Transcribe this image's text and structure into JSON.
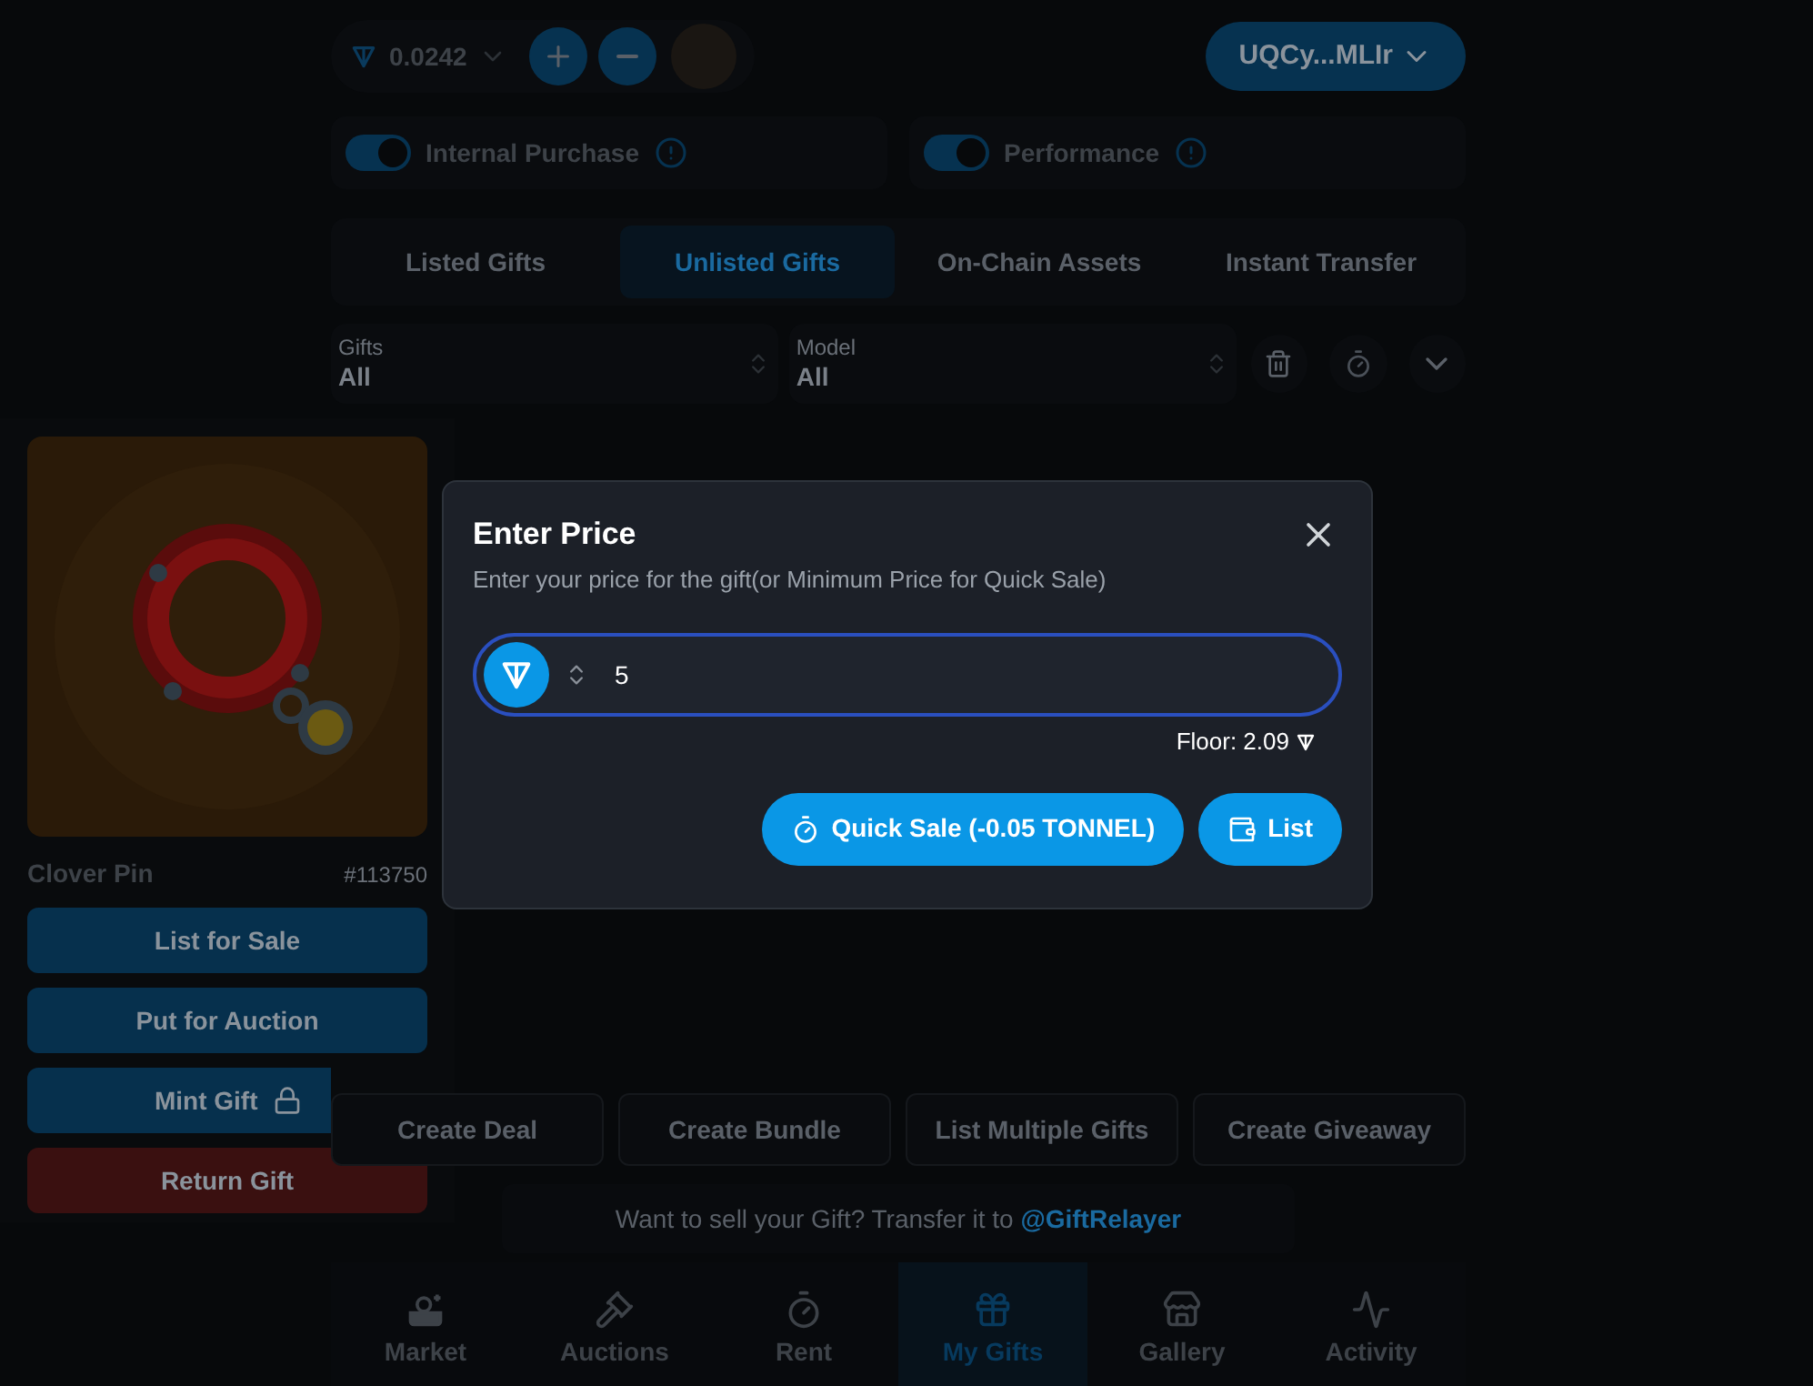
{
  "wallet": {
    "balance": "0.0242",
    "address": "UQCy...MLIr"
  },
  "toggles": [
    {
      "label": "Internal Purchase",
      "on": true
    },
    {
      "label": "Performance",
      "on": true
    }
  ],
  "tabs": [
    {
      "label": "Listed Gifts",
      "selected": false
    },
    {
      "label": "Unlisted Gifts",
      "selected": true
    },
    {
      "label": "On-Chain Assets",
      "selected": false
    },
    {
      "label": "Instant Transfer",
      "selected": false
    }
  ],
  "filters": [
    {
      "label": "Gifts",
      "value": "All"
    },
    {
      "label": "Model",
      "value": "All"
    }
  ],
  "gift": {
    "name": "Clover Pin",
    "number": "#113750",
    "actions": [
      {
        "label": "List for Sale",
        "kind": "primary"
      },
      {
        "label": "Put for Auction",
        "kind": "primary"
      },
      {
        "label": "Mint Gift",
        "kind": "locked"
      },
      {
        "label": "Return Gift",
        "kind": "danger"
      }
    ]
  },
  "actions": [
    "Create Deal",
    "Create Bundle",
    "List Multiple Gifts",
    "Create Giveaway"
  ],
  "info": {
    "text": "Want to sell your Gift? Transfer it to",
    "link": "@GiftRelayer"
  },
  "nav": [
    {
      "label": "Market",
      "selected": false
    },
    {
      "label": "Auctions",
      "selected": false
    },
    {
      "label": "Rent",
      "selected": false
    },
    {
      "label": "My Gifts",
      "selected": true
    },
    {
      "label": "Gallery",
      "selected": false
    },
    {
      "label": "Activity",
      "selected": false
    }
  ],
  "modal": {
    "title": "Enter Price",
    "subtitle": "Enter your price for the gift(or Minimum Price for Quick Sale)",
    "input": {
      "value": "5"
    },
    "floor": "Floor: 2.09",
    "buttons": [
      {
        "label": "Quick Sale (-0.05 TONNEL)",
        "kind": "timer"
      },
      {
        "label": "List",
        "kind": "wallet"
      }
    ]
  }
}
